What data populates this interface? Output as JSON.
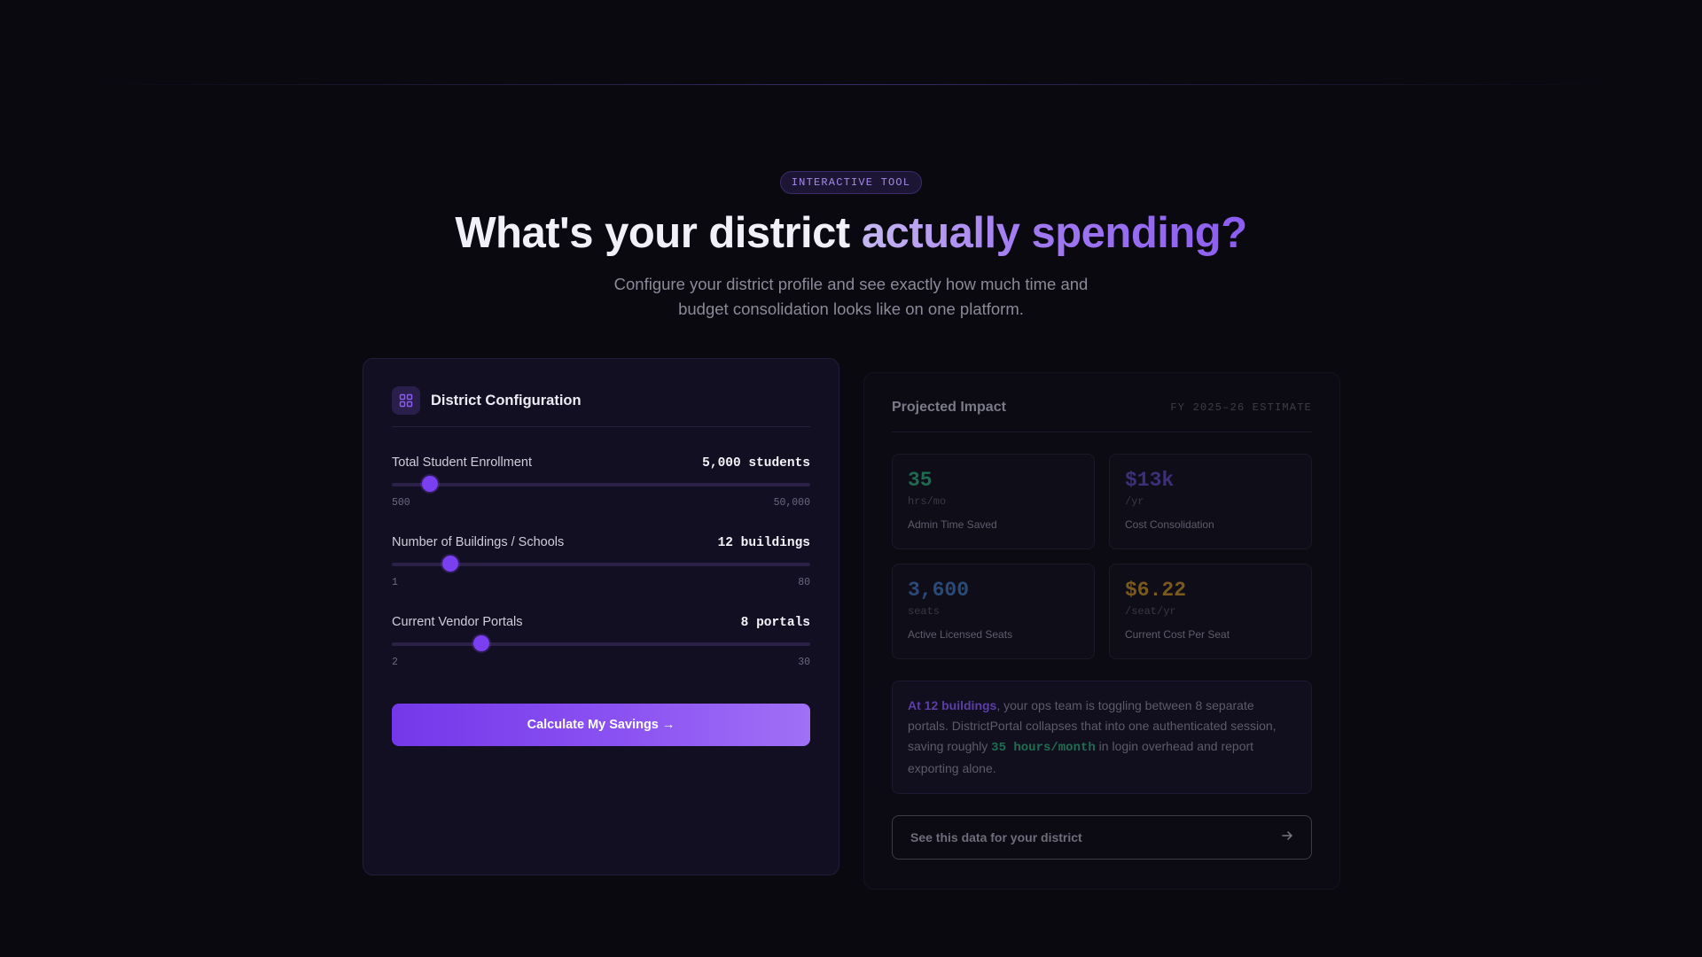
{
  "hero": {
    "badge": "INTERACTIVE TOOL",
    "headline_plain": "What's your district",
    "headline_accent": "actually spending?",
    "subtitle": "Configure your district profile and see exactly how much time and budget consolidation looks like on one platform."
  },
  "config": {
    "icon": "grid-icon",
    "title": "District Configuration",
    "sliders": [
      {
        "label": "Total Student Enrollment",
        "value_text": "5,000 students",
        "min_label": "500",
        "max_label": "50,000",
        "min": 500,
        "max": 50000,
        "value": 5000
      },
      {
        "label": "Number of Buildings / Schools",
        "value_text": "12 buildings",
        "min_label": "1",
        "max_label": "80",
        "min": 1,
        "max": 80,
        "value": 12
      },
      {
        "label": "Current Vendor Portals",
        "value_text": "8 portals",
        "min_label": "2",
        "max_label": "30",
        "min": 2,
        "max": 30,
        "value": 8
      }
    ],
    "button_label": "Calculate My Savings →"
  },
  "impact": {
    "title": "Projected Impact",
    "meta": "FY 2025–26 ESTIMATE",
    "metrics": [
      {
        "value": "35",
        "unit": "hrs/mo",
        "label": "Admin Time Saved",
        "color": "#1d6b50"
      },
      {
        "value": "$13k",
        "unit": "/yr",
        "label": "Cost Consolidation",
        "color": "#3d2f78"
      },
      {
        "value": "3,600",
        "unit": "seats",
        "label": "Active Licensed Seats",
        "color": "#2a4a7a"
      },
      {
        "value": "$6.22",
        "unit": "/seat/yr",
        "label": "Current Cost Per Seat",
        "color": "#7a5a1c"
      }
    ],
    "note": {
      "highlight": "At 12 buildings",
      "part1": ", your ops team is toggling between 8 separate portals. DistrictPortal collapses that into one authenticated session, saving roughly ",
      "hours": "35 hours/month",
      "part2": " in login overhead and report exporting alone."
    },
    "cta_label": "See this data for your district",
    "cta_icon": "arrow-right-icon"
  }
}
